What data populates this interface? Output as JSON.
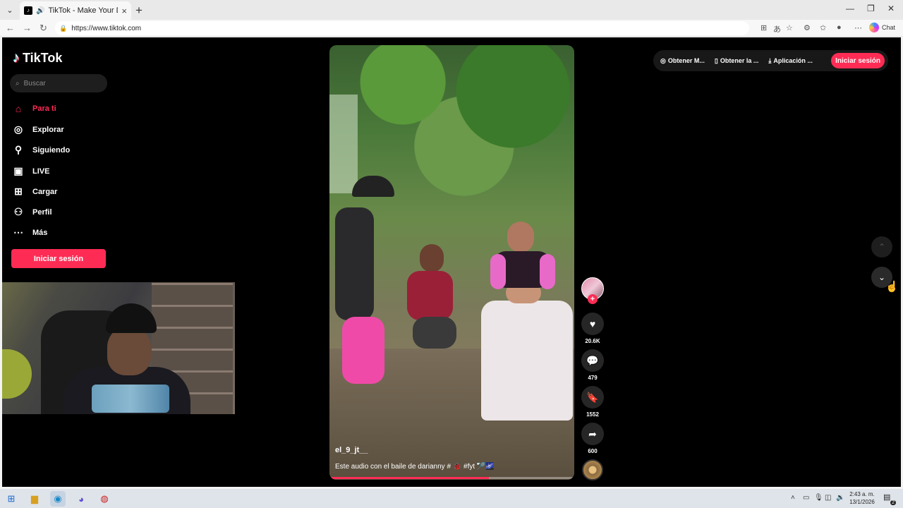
{
  "browser": {
    "tab_title": "TikTok - Make Your Day",
    "url": "https://www.tiktok.com",
    "chat_label": "Chat"
  },
  "sidebar": {
    "logo_text": "TikTok",
    "search_placeholder": "Buscar",
    "items": [
      {
        "label": "Para ti",
        "icon": "home-icon",
        "active": true
      },
      {
        "label": "Explorar",
        "icon": "compass-icon"
      },
      {
        "label": "Siguiendo",
        "icon": "following-icon"
      },
      {
        "label": "LIVE",
        "icon": "live-tv-icon"
      },
      {
        "label": "Cargar",
        "icon": "upload-icon"
      },
      {
        "label": "Perfil",
        "icon": "profile-icon"
      },
      {
        "label": "Más",
        "icon": "more-icon"
      }
    ],
    "login_label": "Iniciar sesión"
  },
  "topbar": {
    "items": [
      {
        "label": "Obtener M...",
        "icon": "coin-icon"
      },
      {
        "label": "Obtener la ...",
        "icon": "phone-icon"
      },
      {
        "label": "Aplicación ...",
        "icon": "download-icon"
      }
    ],
    "login_label": "Iniciar sesión"
  },
  "video": {
    "author": "el_9_jt__",
    "caption": "Este audio con el baile de darianny # 🐞 #fyt 🏸🌌",
    "progress": 0.65,
    "likes": "20.6K",
    "comments": "479",
    "saves": "1552",
    "shares": "600"
  },
  "taskbar": {
    "time": "2:43 a. m.",
    "date": "13/1/2026",
    "notifications": "2"
  },
  "colors": {
    "accent": "#fe2c55",
    "page_bg": "#000000"
  }
}
